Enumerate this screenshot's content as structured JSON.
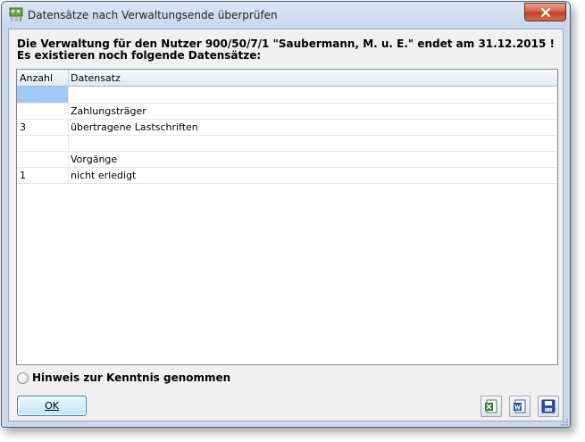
{
  "window": {
    "title": "Datensätze nach Verwaltungsende überprüfen"
  },
  "message": {
    "line1": "Die Verwaltung für den Nutzer 900/50/7/1 \"Saubermann, M. u. E.\" endet am 31.12.2015 !",
    "line2": "Es existieren noch folgende Datensätze:"
  },
  "grid": {
    "columns": [
      "Anzahl",
      "Datensatz"
    ],
    "rows": [
      {
        "count": "",
        "label": ""
      },
      {
        "count": "",
        "label": "Zahlungsträger"
      },
      {
        "count": "3",
        "label": "übertragene Lastschriften"
      },
      {
        "count": "",
        "label": ""
      },
      {
        "count": "",
        "label": "Vorgänge"
      },
      {
        "count": "1",
        "label": "nicht erledigt"
      }
    ]
  },
  "radio": {
    "label": "Hinweis zur Kenntnis genommen"
  },
  "buttons": {
    "ok": "OK",
    "excel_icon": "excel-export-icon",
    "word_icon": "word-export-icon",
    "save_icon": "save-disk-icon"
  }
}
